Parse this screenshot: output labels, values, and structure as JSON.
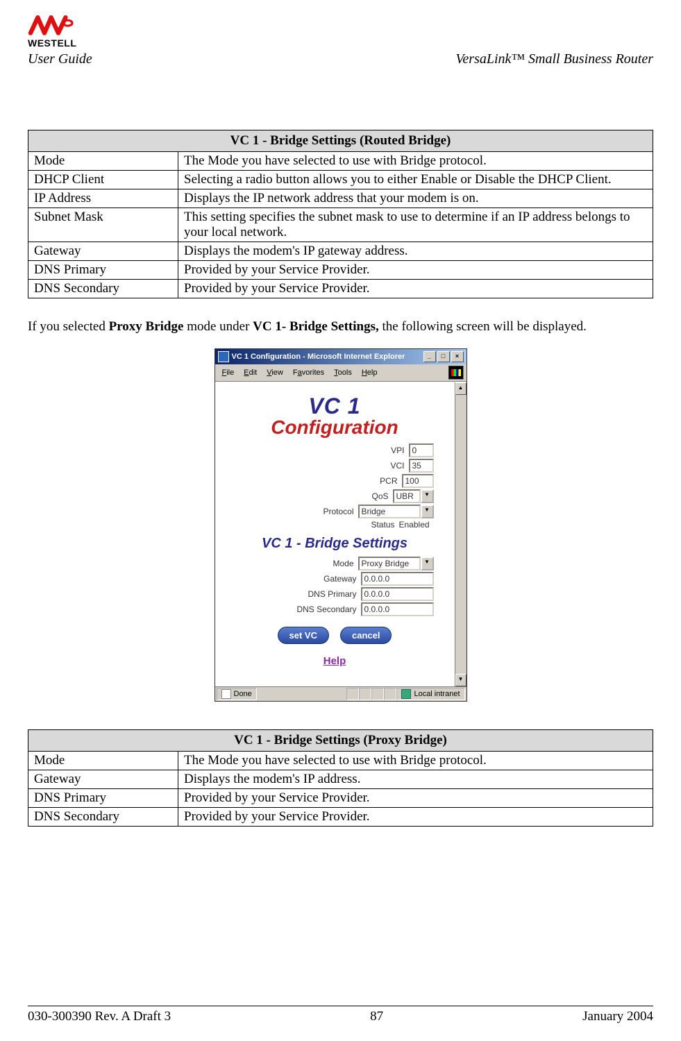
{
  "header": {
    "brand": "WESTELL",
    "user_guide": "User Guide",
    "product": "VersaLink™  Small Business Router"
  },
  "table1": {
    "title": "VC 1 - Bridge Settings (Routed Bridge)",
    "rows": [
      {
        "label": "Mode",
        "desc": "The Mode you have selected to use with Bridge protocol."
      },
      {
        "label": "DHCP Client",
        "desc": "Selecting a radio button allows you to either Enable or Disable the DHCP Client."
      },
      {
        "label": "IP Address",
        "desc": "Displays the IP network address that your modem is on."
      },
      {
        "label": "Subnet Mask",
        "desc": "This setting specifies the subnet mask to use to determine if an IP address belongs to your local network."
      },
      {
        "label": "Gateway",
        "desc": "Displays the modem's IP gateway address."
      },
      {
        "label": "DNS Primary",
        "desc": "Provided by your Service Provider."
      },
      {
        "label": "DNS Secondary",
        "desc": "Provided by your Service Provider."
      }
    ]
  },
  "paragraph": {
    "pre": "If you selected ",
    "b1": "Proxy Bridge",
    "mid": " mode under ",
    "b2": "VC 1- Bridge Settings,",
    "post": " the following screen will be displayed."
  },
  "ie": {
    "title": "VC 1 Configuration - Microsoft Internet Explorer",
    "menu": {
      "file": "File",
      "edit": "Edit",
      "view": "View",
      "favorites": "Favorites",
      "tools": "Tools",
      "help": "Help"
    },
    "heading1": "VC 1",
    "heading2": "Configuration",
    "fields": {
      "vpi": {
        "label": "VPI",
        "value": "0"
      },
      "vci": {
        "label": "VCI",
        "value": "35"
      },
      "pcr": {
        "label": "PCR",
        "value": "100"
      },
      "qos": {
        "label": "QoS",
        "value": "UBR"
      },
      "protocol": {
        "label": "Protocol",
        "value": "Bridge"
      },
      "status": {
        "label": "Status",
        "value": "Enabled"
      }
    },
    "bridge_heading": "VC 1 - Bridge Settings",
    "bridge_fields": {
      "mode": {
        "label": "Mode",
        "value": "Proxy Bridge"
      },
      "gateway": {
        "label": "Gateway",
        "value": "0.0.0.0"
      },
      "dns_primary": {
        "label": "DNS Primary",
        "value": "0.0.0.0"
      },
      "dns_secondary": {
        "label": "DNS Secondary",
        "value": "0.0.0.0"
      }
    },
    "buttons": {
      "set": "set VC",
      "cancel": "cancel"
    },
    "help": "Help",
    "status_done": "Done",
    "status_zone": "Local intranet"
  },
  "table2": {
    "title": "VC 1 - Bridge Settings (Proxy Bridge)",
    "rows": [
      {
        "label": "Mode",
        "desc": "The Mode you have selected to use with Bridge protocol."
      },
      {
        "label": "Gateway",
        "desc": "Displays the modem's IP address."
      },
      {
        "label": "DNS Primary",
        "desc": "Provided by your Service Provider."
      },
      {
        "label": "DNS Secondary",
        "desc": "Provided by your Service Provider."
      }
    ]
  },
  "footer": {
    "left": "030-300390 Rev. A Draft 3",
    "center": "87",
    "right": "January 2004"
  }
}
